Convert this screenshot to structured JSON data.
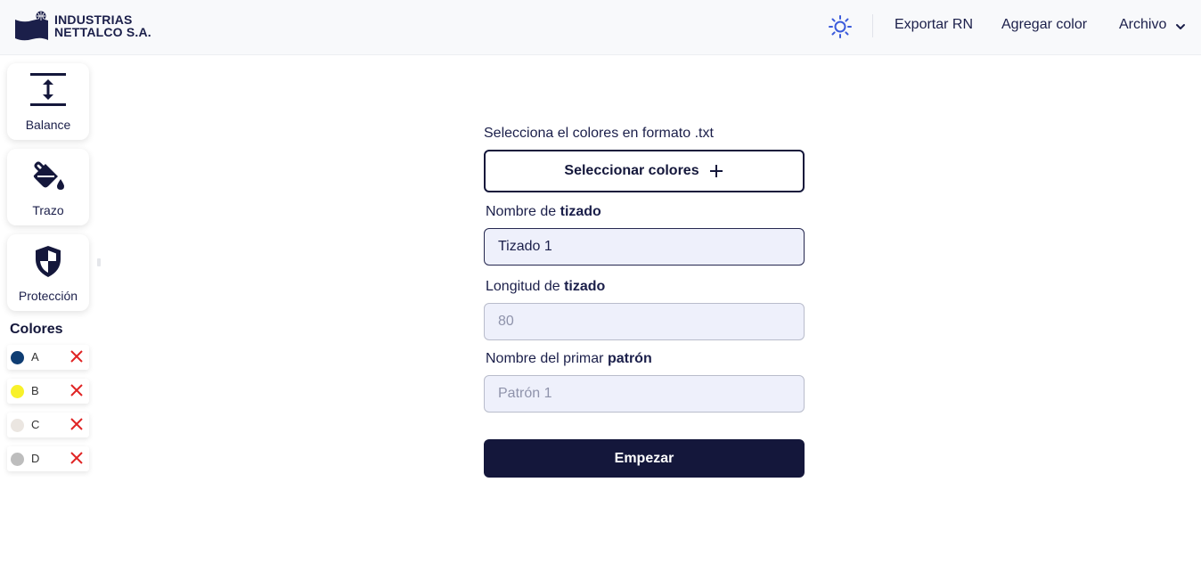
{
  "brand": {
    "line1": "INDUSTRIAS",
    "line2": "NETTALCO S.A.",
    "primary_color": "#14173b"
  },
  "header": {
    "theme_icon": "sun-icon",
    "nav": [
      {
        "label": "Exportar RN"
      },
      {
        "label": "Agregar color"
      },
      {
        "label": "Archivo",
        "icon": "chevron-down-icon"
      }
    ]
  },
  "sidebar": {
    "tools": [
      {
        "label": "Balance",
        "icon": "balance-icon"
      },
      {
        "label": "Trazo",
        "icon": "paint-bucket-icon"
      },
      {
        "label": "Protección",
        "icon": "shield-icon"
      }
    ],
    "colors_title": "Colores",
    "colors": [
      {
        "name": "A",
        "swatch": "#0f3d73"
      },
      {
        "name": "B",
        "swatch": "#f8f12a"
      },
      {
        "name": "C",
        "swatch": "#ebe6e1"
      },
      {
        "name": "D",
        "swatch": "#bdbdbd"
      }
    ],
    "delete_icon": "close-icon",
    "delete_color": "#e02424"
  },
  "form": {
    "file_label": "Selecciona el colores en formato .txt",
    "select_button": "Seleccionar colores",
    "name_label_pre": "Nombre de",
    "name_label_bold": "tizado",
    "name_value": "Tizado 1",
    "length_label_pre": "Longitud de",
    "length_label_bold": "tizado",
    "length_placeholder": "80",
    "pattern_label_pre": "Nombre del primar",
    "pattern_label_bold": "patrón",
    "pattern_placeholder": "Patrón 1",
    "start_button": "Empezar"
  }
}
